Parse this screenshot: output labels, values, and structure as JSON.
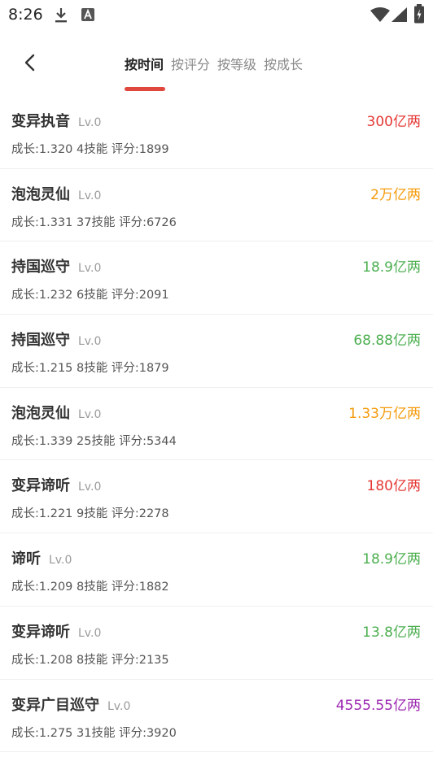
{
  "status": {
    "time": "8:26"
  },
  "header": {
    "tabs": [
      {
        "label": "按时间",
        "active": true
      },
      {
        "label": "按评分",
        "active": false
      },
      {
        "label": "按等级",
        "active": false
      },
      {
        "label": "按成长",
        "active": false
      }
    ]
  },
  "colors": {
    "red": "#e53935",
    "orange": "#f59b0c",
    "green": "#4caf50",
    "purple": "#9c27b0",
    "accent": "#e0483e"
  },
  "items": [
    {
      "name": "变异执音",
      "level": "Lv.0",
      "price": "300亿两",
      "price_color": "#e53935",
      "stats": "成长:1.320 4技能 评分:1899"
    },
    {
      "name": "泡泡灵仙",
      "level": "Lv.0",
      "price": "2万亿两",
      "price_color": "#f59b0c",
      "stats": "成长:1.331 37技能 评分:6726"
    },
    {
      "name": "持国巡守",
      "level": "Lv.0",
      "price": "18.9亿两",
      "price_color": "#4caf50",
      "stats": "成长:1.232 6技能 评分:2091"
    },
    {
      "name": "持国巡守",
      "level": "Lv.0",
      "price": "68.88亿两",
      "price_color": "#4caf50",
      "stats": "成长:1.215 8技能 评分:1879"
    },
    {
      "name": "泡泡灵仙",
      "level": "Lv.0",
      "price": "1.33万亿两",
      "price_color": "#f59b0c",
      "stats": "成长:1.339 25技能 评分:5344"
    },
    {
      "name": "变异谛听",
      "level": "Lv.0",
      "price": "180亿两",
      "price_color": "#e53935",
      "stats": "成长:1.221 9技能 评分:2278"
    },
    {
      "name": "谛听",
      "level": "Lv.0",
      "price": "18.9亿两",
      "price_color": "#4caf50",
      "stats": "成长:1.209 8技能 评分:1882"
    },
    {
      "name": "变异谛听",
      "level": "Lv.0",
      "price": "13.8亿两",
      "price_color": "#4caf50",
      "stats": "成长:1.208 8技能 评分:2135"
    },
    {
      "name": "变异广目巡守",
      "level": "Lv.0",
      "price": "4555.55亿两",
      "price_color": "#9c27b0",
      "stats": "成长:1.275 31技能 评分:3920"
    }
  ]
}
